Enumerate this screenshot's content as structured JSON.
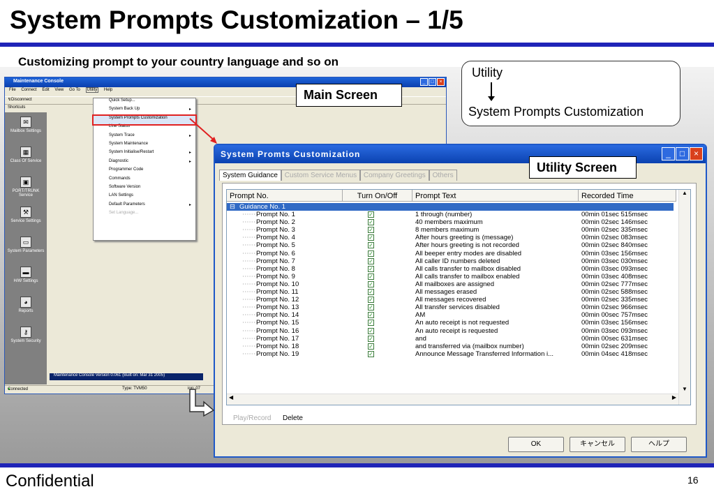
{
  "slide": {
    "title": "System Prompts Customization – 1/5",
    "subtitle": "Customizing prompt to your country language and so on",
    "footer": "Confidential",
    "page": "16"
  },
  "callout": {
    "line1": "Utility",
    "line2": "System Prompts Customization"
  },
  "main_label": "Main Screen",
  "utility_label": "Utility Screen",
  "main_window": {
    "title": "Maintenance Console",
    "menu": [
      "File",
      "Connect",
      "Edit",
      "View",
      "Go To",
      "Utility",
      "Help"
    ],
    "toolbar_disconnect": "Disconnect",
    "shortcuts": "Shortcuts",
    "side": [
      "Mailbox Settings",
      "Class Of Service",
      "PORT/TRUNK Service",
      "Service Settings",
      "System Parameters",
      "H/W Settings",
      "Reports",
      "System Security"
    ],
    "version": "Maintenance Console Version 0.061 (Built on: Mar 31 2005)",
    "status": {
      "connected": "Connected",
      "type": "Type: TVM50",
      "ion": "ion: 07"
    },
    "dropdown": [
      "Quick Setup...",
      "System Back Up",
      "System Prompts Customization",
      "Line Status",
      "System Trace",
      "System Maintenance",
      "System Initialise/Restart",
      "Diagnostic",
      "Programmer Code",
      "Commands",
      "Software Version",
      "LAN Settings",
      "Default Parameters",
      "Set Language..."
    ]
  },
  "utility_window": {
    "title": "System Promts Customization",
    "tabs": [
      "System Guidance",
      "Custom Service Menus",
      "Company Greetings",
      "Others"
    ],
    "columns": [
      "Prompt No.",
      "Turn On/Off",
      "Prompt Text",
      "Recorded Time"
    ],
    "group": "Guidance No. 1",
    "rows": [
      [
        "Prompt No. 1",
        "1 through (number)",
        "00min 01sec 515msec"
      ],
      [
        "Prompt No. 2",
        "40 members maximum",
        "00min 02sec 146msec"
      ],
      [
        "Prompt No. 3",
        "8 members maximum",
        "00min 02sec 335msec"
      ],
      [
        "Prompt No. 4",
        "After hours greeting is (message)",
        "00min 02sec 083msec"
      ],
      [
        "Prompt No. 5",
        "After hours greeting is not recorded",
        "00min 02sec 840msec"
      ],
      [
        "Prompt No. 6",
        "All beeper entry modes are disabled",
        "00min 03sec 156msec"
      ],
      [
        "Prompt No. 7",
        "All caller ID numbers deleted",
        "00min 03sec 030msec"
      ],
      [
        "Prompt No. 8",
        "All calls transfer to mailbox disabled",
        "00min 03sec 093msec"
      ],
      [
        "Prompt No. 9",
        "All calls transfer to mailbox enabled",
        "00min 03sec 408msec"
      ],
      [
        "Prompt No. 10",
        "All mailboxes are assigned",
        "00min 02sec 777msec"
      ],
      [
        "Prompt No. 11",
        "All messages erased",
        "00min 02sec 588msec"
      ],
      [
        "Prompt No. 12",
        "All messages recovered",
        "00min 02sec 335msec"
      ],
      [
        "Prompt No. 13",
        "All transfer services disabled",
        "00min 02sec 966msec"
      ],
      [
        "Prompt No. 14",
        "AM",
        "00min 00sec 757msec"
      ],
      [
        "Prompt No. 15",
        "An auto receipt is not requested",
        "00min 03sec 156msec"
      ],
      [
        "Prompt No. 16",
        "An auto receipt is requested",
        "00min 03sec 093msec"
      ],
      [
        "Prompt No. 17",
        "and",
        "00min 00sec 631msec"
      ],
      [
        "Prompt No. 18",
        "and transferred via (mailbox number)",
        "00min 02sec 209msec"
      ],
      [
        "Prompt No. 19",
        "Announce Message Transferred Information i...",
        "00min 04sec 418msec"
      ]
    ],
    "play_record": "Play/Record",
    "delete": "Delete",
    "ok": "OK",
    "cancel": "キャンセル",
    "help": "ヘルプ"
  }
}
